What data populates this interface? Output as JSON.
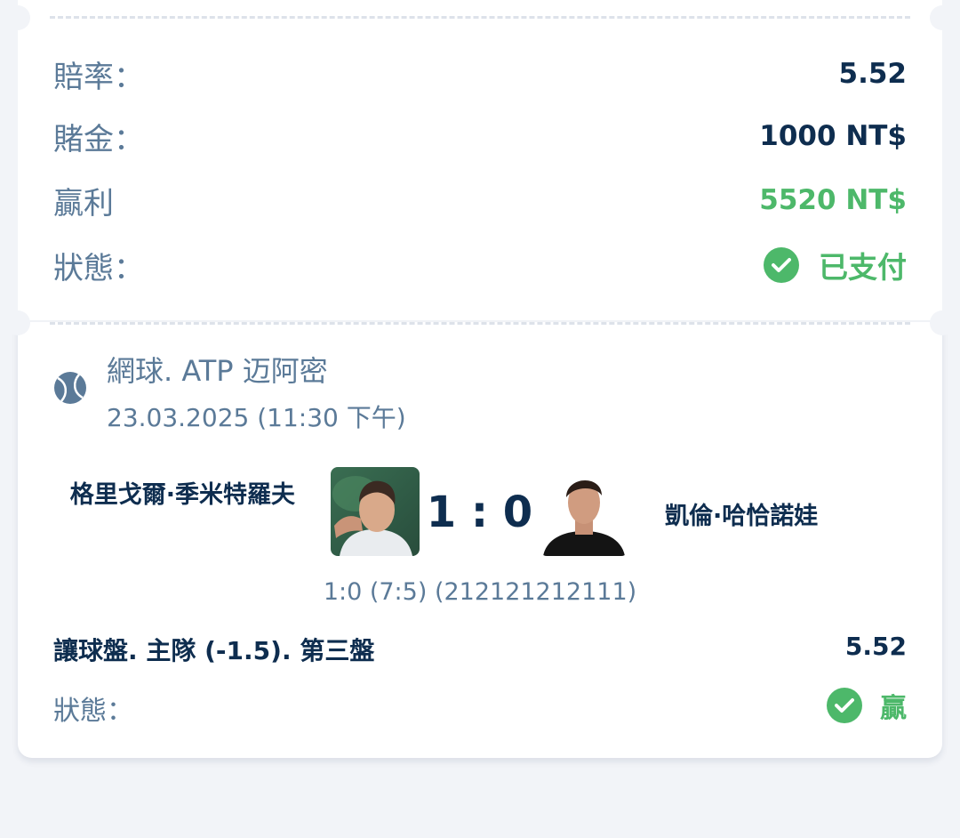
{
  "summary": {
    "odds_label": "賠率：",
    "odds_value": "5.52",
    "stake_label": "賭金：",
    "stake_value": "1000 NT$",
    "win_label": "贏利",
    "win_value": "5520 NT$",
    "status_label": "狀態：",
    "status_value": "已支付"
  },
  "event": {
    "sport_icon": "tennis-ball-icon",
    "title": "網球. ATP 迈阿密",
    "datetime": "23.03.2025 (11:30 下午)"
  },
  "match": {
    "home_player": "格里戈爾·季米特羅夫",
    "away_player": "凱倫·哈恰諾娃",
    "score": "1 : 0",
    "set_detail": "1:0 (7:5) (212121212111)"
  },
  "bet": {
    "market": "讓球盤. 主隊 (-1.5). 第三盤",
    "odds": "5.52",
    "status_label": "狀態：",
    "status_value": "贏"
  },
  "colors": {
    "navy": "#0e2d4f",
    "muted": "#5b7a98",
    "green": "#4db86a",
    "background": "#f2f4f8"
  }
}
